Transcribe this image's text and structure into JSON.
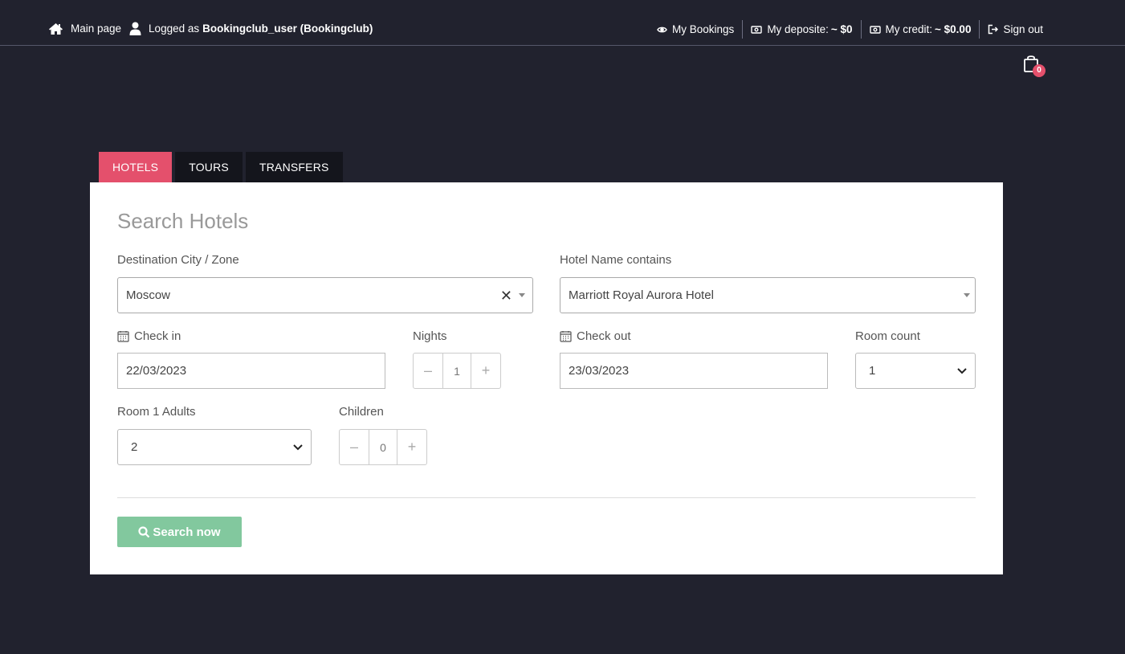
{
  "topbar": {
    "main_page": "Main page",
    "logged_as_prefix": "Logged as",
    "logged_user": "Bookingclub_user (Bookingclub)",
    "my_bookings": "My Bookings",
    "deposit_label": "My deposite:",
    "deposit_value": "~ $0",
    "credit_label": "My credit:",
    "credit_value": "~ $0.00",
    "sign_out": "Sign out",
    "cart_count": "0"
  },
  "tabs": [
    {
      "label": "HOTELS",
      "active": true
    },
    {
      "label": "TOURS",
      "active": false
    },
    {
      "label": "TRANSFERS",
      "active": false
    }
  ],
  "form": {
    "title": "Search Hotels",
    "destination_label": "Destination City / Zone",
    "destination_value": "Moscow",
    "hotel_name_label": "Hotel Name contains",
    "hotel_name_value": "Marriott Royal Aurora Hotel",
    "checkin_label": "Check in",
    "checkin_value": "22/03/2023",
    "nights_label": "Nights",
    "nights_value": "1",
    "checkout_label": "Check out",
    "checkout_value": "23/03/2023",
    "room_count_label": "Room count",
    "room_count_value": "1",
    "adults_label": "Room 1 Adults",
    "adults_value": "2",
    "children_label": "Children",
    "children_value": "0",
    "search_button": "Search now"
  },
  "colors": {
    "background": "#21222e",
    "accent": "#e4506c",
    "search_button": "#82c89e"
  }
}
